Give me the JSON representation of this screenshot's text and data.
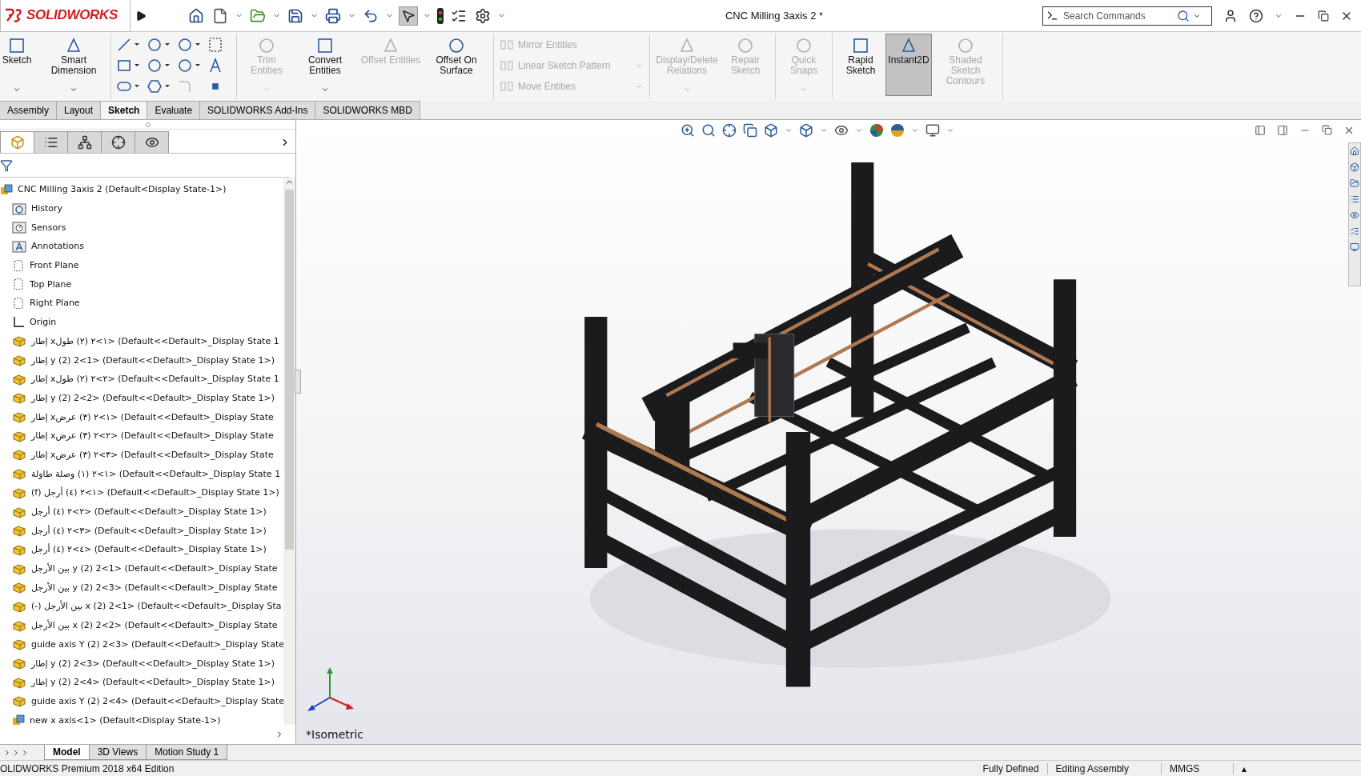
{
  "window": {
    "title": "CNC Milling 3axis 2 *",
    "logo": "SOLIDWORKS",
    "search": {
      "placeholder": "Search Commands"
    }
  },
  "ribbon": {
    "groups": [
      {
        "kind": "large",
        "items": [
          {
            "label": "Sketch",
            "disabled": false,
            "selected": false,
            "menu": true
          },
          {
            "label": "Smart Dimension",
            "disabled": false,
            "selected": false,
            "menu": true
          }
        ]
      },
      {
        "kind": "tools"
      },
      {
        "kind": "large",
        "items": [
          {
            "label": "Trim Entities",
            "disabled": true,
            "selected": false,
            "menu": true
          },
          {
            "label": "Convert Entities",
            "disabled": false,
            "selected": false,
            "menu": true
          },
          {
            "label": "Offset Entities",
            "disabled": true,
            "selected": false,
            "menu": false
          },
          {
            "label": "Offset On Surface",
            "disabled": false,
            "selected": false,
            "menu": false
          }
        ]
      },
      {
        "kind": "small",
        "items": [
          {
            "label": "Mirror Entities",
            "disabled": true,
            "menu": false
          },
          {
            "label": "Linear Sketch Pattern",
            "disabled": true,
            "menu": true
          },
          {
            "label": "Move Entities",
            "disabled": true,
            "menu": true
          }
        ]
      },
      {
        "kind": "large",
        "items": [
          {
            "label": "Display/Delete Relations",
            "disabled": true,
            "selected": false,
            "menu": true
          },
          {
            "label": "Repair Sketch",
            "disabled": true,
            "selected": false,
            "menu": false
          }
        ]
      },
      {
        "kind": "large",
        "items": [
          {
            "label": "Quick Snaps",
            "disabled": true,
            "selected": false,
            "menu": true
          }
        ]
      },
      {
        "kind": "large",
        "items": [
          {
            "label": "Rapid Sketch",
            "disabled": false,
            "selected": false,
            "menu": false
          },
          {
            "label": "Instant2D",
            "disabled": false,
            "selected": true,
            "menu": false
          },
          {
            "label": "Shaded Sketch Contours",
            "disabled": true,
            "selected": false,
            "menu": false
          }
        ]
      }
    ]
  },
  "command_tabs": [
    {
      "label": "Assembly",
      "selected": false
    },
    {
      "label": "Layout",
      "selected": false
    },
    {
      "label": "Sketch",
      "selected": true
    },
    {
      "label": "Evaluate",
      "selected": false
    },
    {
      "label": "SOLIDWORKS Add-Ins",
      "selected": false
    },
    {
      "label": "SOLIDWORKS MBD",
      "selected": false
    }
  ],
  "panel_tabs": [
    {
      "selected": true
    },
    {
      "selected": false
    },
    {
      "selected": false
    },
    {
      "selected": false
    },
    {
      "selected": false
    }
  ],
  "tree": {
    "root": {
      "label": "CNC Milling 3axis 2  (Default<Display State-1>)",
      "kind": "assembly"
    },
    "children": [
      {
        "label": "History",
        "kind": "history"
      },
      {
        "label": "Sensors",
        "kind": "sensors"
      },
      {
        "label": "Annotations",
        "kind": "annotations"
      },
      {
        "label": "Front Plane",
        "kind": "plane"
      },
      {
        "label": "Top Plane",
        "kind": "plane"
      },
      {
        "label": "Right Plane",
        "kind": "plane"
      },
      {
        "label": "Origin",
        "kind": "origin"
      },
      {
        "label": "إطار x١>٢ (٢) طول> (Default<<Default>_Display State 1",
        "kind": "part"
      },
      {
        "label": "إطار y (2) 2<1> (Default<<Default>_Display State 1>)",
        "kind": "part"
      },
      {
        "label": "إطار x٢>٢ (٢) طول> (Default<<Default>_Display State 1",
        "kind": "part"
      },
      {
        "label": "إطار y (2) 2<2> (Default<<Default>_Display State 1>)",
        "kind": "part"
      },
      {
        "label": "إطار x١>٢ (٣) عرض> (Default<<Default>_Display State",
        "kind": "part"
      },
      {
        "label": "إطار x٢>٢ (٣) عرض> (Default<<Default>_Display State",
        "kind": "part"
      },
      {
        "label": "إطار x٣>٢ (٣) عرض> (Default<<Default>_Display State",
        "kind": "part"
      },
      {
        "label": "١>٢ (١) وصلة طاولة> (Default<<Default>_Display State 1",
        "kind": "part"
      },
      {
        "label": "(f) ١>٢ (٤) أرجل> (Default<<Default>_Display State 1>)",
        "kind": "part"
      },
      {
        "label": "٢>٢ (٤) أرجل> (Default<<Default>_Display State 1>)",
        "kind": "part"
      },
      {
        "label": "٣>٢ (٤) أرجل> (Default<<Default>_Display State 1>)",
        "kind": "part"
      },
      {
        "label": "٤>٢ (٤) أرجل> (Default<<Default>_Display State 1>)",
        "kind": "part"
      },
      {
        "label": "بين الأرجل y (2) 2<1> (Default<<Default>_Display State",
        "kind": "part"
      },
      {
        "label": "بين الأرجل y (2) 2<3> (Default<<Default>_Display State",
        "kind": "part"
      },
      {
        "label": "(-) بين الأرجل x (2) 2<1> (Default<<Default>_Display Sta",
        "kind": "part"
      },
      {
        "label": "بين الأرجل x (2) 2<2> (Default<<Default>_Display State",
        "kind": "part"
      },
      {
        "label": "guide axis Y (2) 2<3> (Default<<Default>_Display State",
        "kind": "part"
      },
      {
        "label": "إطار y (2) 2<3> (Default<<Default>_Display State 1>)",
        "kind": "part"
      },
      {
        "label": "إطار y (2) 2<4> (Default<<Default>_Display State 1>)",
        "kind": "part"
      },
      {
        "label": "guide axis Y (2) 2<4> (Default<<Default>_Display State",
        "kind": "part"
      },
      {
        "label": "new x axis<1> (Default<Display State-1>)",
        "kind": "assembly"
      }
    ]
  },
  "viewport": {
    "view_name": "*Isometric"
  },
  "bottom_tabs": [
    {
      "label": "Model",
      "selected": true
    },
    {
      "label": "3D Views",
      "selected": false
    },
    {
      "label": "Motion Study 1",
      "selected": false
    }
  ],
  "status_bar": {
    "edition": "OLIDWORKS Premium 2018 x64 Edition",
    "items": [
      "Fully Defined",
      "Editing Assembly",
      "MMGS",
      "▴"
    ]
  }
}
